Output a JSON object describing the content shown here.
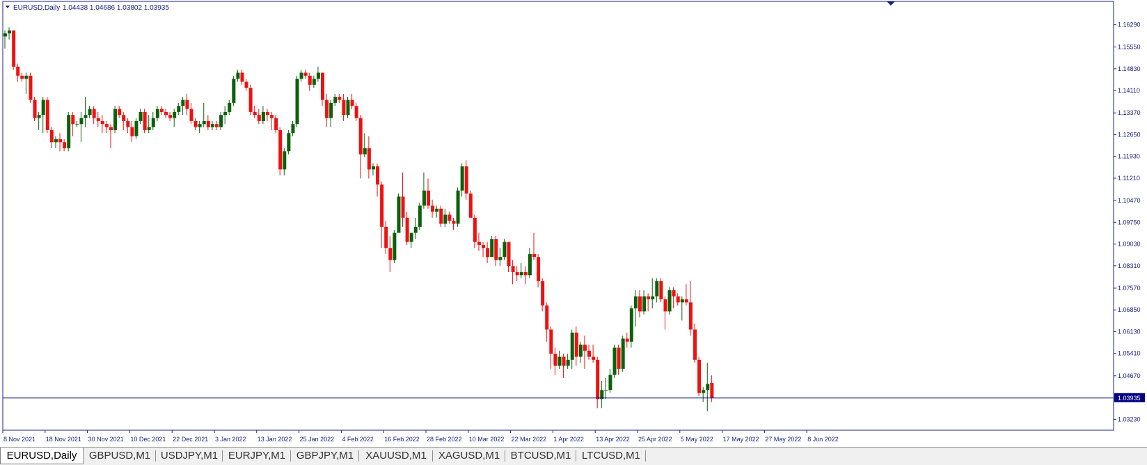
{
  "header": {
    "symbol_label": "EURUSD,Daily",
    "ohlc_label": "1.04438 1.04686 1.03802 1.03935"
  },
  "current_price_label": "1.03935",
  "colors": {
    "bull": "#0b610b",
    "bear": "#ee1111",
    "axis_text": "#1a237e",
    "frame": "#1a237e",
    "price_line": "#000080",
    "price_tag": "#000080"
  },
  "chart_data": {
    "type": "candlestick",
    "symbol": "EURUSD",
    "timeframe": "Daily",
    "ylim": [
      1.0287,
      1.1706
    ],
    "grid": false,
    "y_ticks": [
      1.1629,
      1.1555,
      1.1483,
      1.1411,
      1.1337,
      1.1265,
      1.1193,
      1.1121,
      1.1047,
      1.0975,
      1.0903,
      1.0831,
      1.0757,
      1.0685,
      1.0613,
      1.0541,
      1.0467,
      1.0323
    ],
    "y_tick_labels": [
      "1.16290",
      "1.15550",
      "1.14830",
      "1.14110",
      "1.13370",
      "1.12650",
      "1.11930",
      "1.11210",
      "1.10470",
      "1.09750",
      "1.09030",
      "1.08310",
      "1.07570",
      "1.06850",
      "1.06130",
      "1.05410",
      "1.04670",
      "1.03230"
    ],
    "current_price": 1.03935,
    "x_labels": [
      {
        "index": 0,
        "label": "8 Nov 2021"
      },
      {
        "index": 10,
        "label": "18 Nov 2021"
      },
      {
        "index": 20,
        "label": "30 Nov 2021"
      },
      {
        "index": 30,
        "label": "10 Dec 2021"
      },
      {
        "index": 40,
        "label": "22 Dec 2021"
      },
      {
        "index": 50,
        "label": "3 Jan 2022"
      },
      {
        "index": 60,
        "label": "13 Jan 2022"
      },
      {
        "index": 70,
        "label": "25 Jan 2022"
      },
      {
        "index": 80,
        "label": "4 Feb 2022"
      },
      {
        "index": 90,
        "label": "16 Feb 2022"
      },
      {
        "index": 100,
        "label": "28 Feb 2022"
      },
      {
        "index": 110,
        "label": "10 Mar 2022"
      },
      {
        "index": 120,
        "label": "22 Mar 2022"
      },
      {
        "index": 130,
        "label": "1 Apr 2022"
      },
      {
        "index": 140,
        "label": "13 Apr 2022"
      },
      {
        "index": 150,
        "label": "25 Apr 2022"
      },
      {
        "index": 160,
        "label": "5 May 2022"
      },
      {
        "index": 170,
        "label": "17 May 2022"
      },
      {
        "index": 180,
        "label": "27 May 2022"
      },
      {
        "index": 190,
        "label": "8 Jun 2022"
      }
    ],
    "candles": [
      [
        1.159,
        1.161,
        1.155,
        1.16
      ],
      [
        1.16,
        1.162,
        1.158,
        1.161
      ],
      [
        1.161,
        1.161,
        1.148,
        1.149
      ],
      [
        1.149,
        1.15,
        1.144,
        1.146
      ],
      [
        1.146,
        1.147,
        1.144,
        1.145
      ],
      [
        1.145,
        1.147,
        1.14,
        1.146
      ],
      [
        1.146,
        1.147,
        1.137,
        1.138
      ],
      [
        1.138,
        1.139,
        1.131,
        1.132
      ],
      [
        1.132,
        1.134,
        1.128,
        1.133
      ],
      [
        1.133,
        1.139,
        1.127,
        1.138
      ],
      [
        1.138,
        1.139,
        1.127,
        1.128
      ],
      [
        1.128,
        1.129,
        1.122,
        1.124
      ],
      [
        1.124,
        1.126,
        1.122,
        1.125
      ],
      [
        1.125,
        1.127,
        1.121,
        1.124
      ],
      [
        1.124,
        1.125,
        1.121,
        1.122
      ],
      [
        1.122,
        1.134,
        1.121,
        1.133
      ],
      [
        1.133,
        1.134,
        1.126,
        1.13
      ],
      [
        1.13,
        1.131,
        1.129,
        1.13
      ],
      [
        1.13,
        1.134,
        1.124,
        1.132
      ],
      [
        1.132,
        1.139,
        1.129,
        1.133
      ],
      [
        1.133,
        1.136,
        1.132,
        1.135
      ],
      [
        1.135,
        1.136,
        1.13,
        1.132
      ],
      [
        1.132,
        1.134,
        1.129,
        1.131
      ],
      [
        1.131,
        1.133,
        1.127,
        1.13
      ],
      [
        1.13,
        1.131,
        1.127,
        1.129
      ],
      [
        1.129,
        1.13,
        1.122,
        1.128
      ],
      [
        1.128,
        1.136,
        1.127,
        1.135
      ],
      [
        1.135,
        1.136,
        1.132,
        1.133
      ],
      [
        1.133,
        1.134,
        1.128,
        1.131
      ],
      [
        1.131,
        1.132,
        1.127,
        1.129
      ],
      [
        1.129,
        1.131,
        1.124,
        1.126
      ],
      [
        1.126,
        1.132,
        1.125,
        1.131
      ],
      [
        1.131,
        1.135,
        1.13,
        1.134
      ],
      [
        1.134,
        1.135,
        1.127,
        1.128
      ],
      [
        1.128,
        1.133,
        1.127,
        1.129
      ],
      [
        1.129,
        1.134,
        1.128,
        1.132
      ],
      [
        1.132,
        1.136,
        1.131,
        1.135
      ],
      [
        1.135,
        1.136,
        1.133,
        1.134
      ],
      [
        1.134,
        1.135,
        1.132,
        1.133
      ],
      [
        1.133,
        1.134,
        1.131,
        1.132
      ],
      [
        1.132,
        1.135,
        1.129,
        1.134
      ],
      [
        1.134,
        1.137,
        1.133,
        1.136
      ],
      [
        1.136,
        1.139,
        1.133,
        1.138
      ],
      [
        1.138,
        1.14,
        1.133,
        1.135
      ],
      [
        1.135,
        1.137,
        1.13,
        1.131
      ],
      [
        1.131,
        1.132,
        1.128,
        1.129
      ],
      [
        1.129,
        1.131,
        1.127,
        1.13
      ],
      [
        1.13,
        1.137,
        1.129,
        1.131
      ],
      [
        1.131,
        1.133,
        1.128,
        1.129
      ],
      [
        1.129,
        1.131,
        1.128,
        1.13
      ],
      [
        1.13,
        1.131,
        1.128,
        1.129
      ],
      [
        1.129,
        1.134,
        1.128,
        1.133
      ],
      [
        1.133,
        1.136,
        1.13,
        1.134
      ],
      [
        1.134,
        1.138,
        1.133,
        1.137
      ],
      [
        1.137,
        1.146,
        1.136,
        1.145
      ],
      [
        1.145,
        1.148,
        1.144,
        1.147
      ],
      [
        1.147,
        1.148,
        1.143,
        1.144
      ],
      [
        1.144,
        1.145,
        1.141,
        1.142
      ],
      [
        1.142,
        1.143,
        1.133,
        1.134
      ],
      [
        1.134,
        1.136,
        1.132,
        1.133
      ],
      [
        1.133,
        1.135,
        1.13,
        1.131
      ],
      [
        1.131,
        1.136,
        1.13,
        1.134
      ],
      [
        1.134,
        1.135,
        1.131,
        1.133
      ],
      [
        1.133,
        1.134,
        1.128,
        1.132
      ],
      [
        1.132,
        1.133,
        1.127,
        1.128
      ],
      [
        1.128,
        1.129,
        1.113,
        1.115
      ],
      [
        1.115,
        1.122,
        1.113,
        1.121
      ],
      [
        1.121,
        1.128,
        1.12,
        1.127
      ],
      [
        1.127,
        1.131,
        1.126,
        1.13
      ],
      [
        1.13,
        1.146,
        1.129,
        1.145
      ],
      [
        1.145,
        1.148,
        1.144,
        1.147
      ],
      [
        1.147,
        1.148,
        1.145,
        1.146
      ],
      [
        1.146,
        1.147,
        1.141,
        1.143
      ],
      [
        1.143,
        1.146,
        1.142,
        1.145
      ],
      [
        1.145,
        1.149,
        1.144,
        1.147
      ],
      [
        1.147,
        1.147,
        1.136,
        1.138
      ],
      [
        1.138,
        1.14,
        1.129,
        1.132
      ],
      [
        1.132,
        1.138,
        1.129,
        1.137
      ],
      [
        1.137,
        1.14,
        1.136,
        1.139
      ],
      [
        1.139,
        1.14,
        1.137,
        1.138
      ],
      [
        1.138,
        1.14,
        1.131,
        1.133
      ],
      [
        1.133,
        1.139,
        1.132,
        1.138
      ],
      [
        1.138,
        1.14,
        1.135,
        1.136
      ],
      [
        1.136,
        1.137,
        1.131,
        1.132
      ],
      [
        1.132,
        1.133,
        1.112,
        1.12
      ],
      [
        1.12,
        1.127,
        1.119,
        1.122
      ],
      [
        1.122,
        1.126,
        1.112,
        1.115
      ],
      [
        1.115,
        1.117,
        1.113,
        1.116
      ],
      [
        1.116,
        1.117,
        1.106,
        1.11
      ],
      [
        1.11,
        1.111,
        1.089,
        1.096
      ],
      [
        1.096,
        1.098,
        1.087,
        1.089
      ],
      [
        1.089,
        1.093,
        1.081,
        1.085
      ],
      [
        1.085,
        1.095,
        1.084,
        1.094
      ],
      [
        1.094,
        1.107,
        1.094,
        1.106
      ],
      [
        1.106,
        1.114,
        1.096,
        1.099
      ],
      [
        1.099,
        1.101,
        1.09,
        1.091
      ],
      [
        1.091,
        1.094,
        1.089,
        1.094
      ],
      [
        1.094,
        1.099,
        1.092,
        1.096
      ],
      [
        1.096,
        1.104,
        1.095,
        1.103
      ],
      [
        1.103,
        1.114,
        1.102,
        1.108
      ],
      [
        1.108,
        1.112,
        1.102,
        1.103
      ],
      [
        1.103,
        1.105,
        1.099,
        1.101
      ],
      [
        1.101,
        1.103,
        1.099,
        1.102
      ],
      [
        1.102,
        1.103,
        1.096,
        1.097
      ],
      [
        1.097,
        1.102,
        1.096,
        1.1
      ],
      [
        1.1,
        1.101,
        1.097,
        1.098
      ],
      [
        1.098,
        1.099,
        1.095,
        1.097
      ],
      [
        1.097,
        1.109,
        1.096,
        1.108
      ],
      [
        1.108,
        1.117,
        1.106,
        1.116
      ],
      [
        1.116,
        1.118,
        1.105,
        1.107
      ],
      [
        1.107,
        1.108,
        1.1,
        1.099
      ],
      [
        1.099,
        1.1,
        1.089,
        1.091
      ],
      [
        1.091,
        1.094,
        1.088,
        1.09
      ],
      [
        1.09,
        1.091,
        1.086,
        1.089
      ],
      [
        1.089,
        1.091,
        1.084,
        1.086
      ],
      [
        1.086,
        1.093,
        1.086,
        1.092
      ],
      [
        1.092,
        1.093,
        1.083,
        1.085
      ],
      [
        1.085,
        1.089,
        1.083,
        1.086
      ],
      [
        1.086,
        1.092,
        1.085,
        1.091
      ],
      [
        1.091,
        1.091,
        1.081,
        1.083
      ],
      [
        1.083,
        1.085,
        1.077,
        1.081
      ],
      [
        1.081,
        1.083,
        1.078,
        1.08
      ],
      [
        1.08,
        1.084,
        1.079,
        1.081
      ],
      [
        1.081,
        1.083,
        1.077,
        1.08
      ],
      [
        1.08,
        1.089,
        1.079,
        1.087
      ],
      [
        1.087,
        1.094,
        1.085,
        1.086
      ],
      [
        1.086,
        1.087,
        1.076,
        1.078
      ],
      [
        1.078,
        1.079,
        1.068,
        1.07
      ],
      [
        1.07,
        1.071,
        1.058,
        1.062
      ],
      [
        1.062,
        1.063,
        1.049,
        1.054
      ],
      [
        1.054,
        1.056,
        1.047,
        1.05
      ],
      [
        1.05,
        1.055,
        1.049,
        1.053
      ],
      [
        1.053,
        1.054,
        1.046,
        1.05
      ],
      [
        1.05,
        1.054,
        1.049,
        1.052
      ],
      [
        1.052,
        1.062,
        1.049,
        1.061
      ],
      [
        1.061,
        1.063,
        1.05,
        1.053
      ],
      [
        1.053,
        1.058,
        1.051,
        1.057
      ],
      [
        1.057,
        1.06,
        1.049,
        1.055
      ],
      [
        1.055,
        1.057,
        1.052,
        1.053
      ],
      [
        1.053,
        1.057,
        1.051,
        1.052
      ],
      [
        1.052,
        1.053,
        1.036,
        1.039
      ],
      [
        1.039,
        1.045,
        1.036,
        1.042
      ],
      [
        1.042,
        1.046,
        1.039,
        1.042
      ],
      [
        1.042,
        1.049,
        1.041,
        1.047
      ],
      [
        1.047,
        1.057,
        1.046,
        1.056
      ],
      [
        1.056,
        1.057,
        1.047,
        1.049
      ],
      [
        1.049,
        1.06,
        1.048,
        1.059
      ],
      [
        1.059,
        1.061,
        1.056,
        1.058
      ],
      [
        1.058,
        1.07,
        1.056,
        1.069
      ],
      [
        1.069,
        1.075,
        1.063,
        1.073
      ],
      [
        1.073,
        1.075,
        1.066,
        1.068
      ],
      [
        1.068,
        1.075,
        1.067,
        1.073
      ],
      [
        1.073,
        1.074,
        1.068,
        1.072
      ],
      [
        1.072,
        1.079,
        1.069,
        1.073
      ],
      [
        1.073,
        1.079,
        1.071,
        1.078
      ],
      [
        1.078,
        1.079,
        1.071,
        1.072
      ],
      [
        1.072,
        1.073,
        1.062,
        1.068
      ],
      [
        1.068,
        1.076,
        1.067,
        1.075
      ],
      [
        1.075,
        1.076,
        1.069,
        1.073
      ],
      [
        1.073,
        1.074,
        1.07,
        1.071
      ],
      [
        1.071,
        1.073,
        1.065,
        1.072
      ],
      [
        1.072,
        1.077,
        1.07,
        1.071
      ],
      [
        1.071,
        1.078,
        1.06,
        1.062
      ],
      [
        1.062,
        1.064,
        1.051,
        1.052
      ],
      [
        1.052,
        1.053,
        1.04,
        1.041
      ],
      [
        1.041,
        1.043,
        1.038,
        1.042
      ],
      [
        1.042,
        1.051,
        1.035,
        1.044
      ],
      [
        1.04438,
        1.04686,
        1.03802,
        1.03935
      ]
    ]
  },
  "tabs": [
    {
      "label": "EURUSD,Daily",
      "active": true
    },
    {
      "label": "GBPUSD,M1",
      "active": false
    },
    {
      "label": "USDJPY,M1",
      "active": false
    },
    {
      "label": "EURJPY,M1",
      "active": false
    },
    {
      "label": "GBPJPY,M1",
      "active": false
    },
    {
      "label": "XAUUSD,M1",
      "active": false
    },
    {
      "label": "XAGUSD,M1",
      "active": false
    },
    {
      "label": "BTCUSD,M1",
      "active": false
    },
    {
      "label": "LTCUSD,M1",
      "active": false
    }
  ]
}
